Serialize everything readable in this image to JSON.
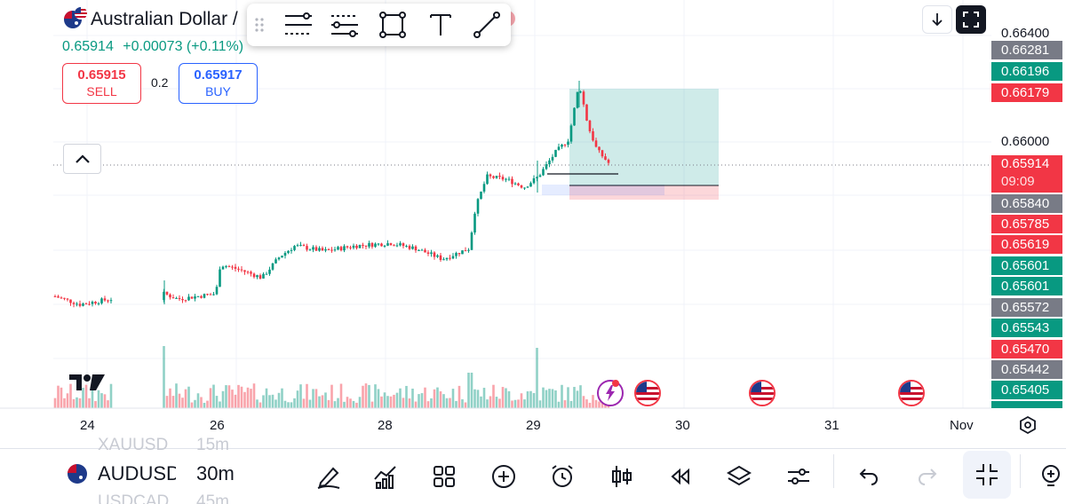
{
  "header": {
    "title": "Australian Dollar /",
    "last_price": "0.65914",
    "change": "+0.00073 (+0.11%)",
    "sell_price": "0.65915",
    "sell_label": "SELL",
    "buy_price": "0.65917",
    "buy_label": "BUY",
    "spread": "0.2"
  },
  "drawing_toolbar": {
    "tools": [
      "drag-handle-icon",
      "long-position-icon",
      "short-position-icon",
      "rectangle-icon",
      "text-icon",
      "trend-line-icon"
    ]
  },
  "top_right": {
    "buttons": [
      "arrow-down-icon",
      "fullscreen-icon"
    ]
  },
  "price_axis": {
    "plain_ticks": [
      "0.66400",
      "0.66000"
    ],
    "badges": [
      {
        "value": "0.66281",
        "color": "#787b86"
      },
      {
        "value": "0.66196",
        "color": "#089981"
      },
      {
        "value": "0.66179",
        "color": "#f23645"
      },
      {
        "value": "0.65914",
        "color": "#f23645",
        "sub": "09:09"
      },
      {
        "value": "0.65840",
        "color": "#787b86"
      },
      {
        "value": "0.65785",
        "color": "#f23645"
      },
      {
        "value": "0.65619",
        "color": "#f23645"
      },
      {
        "value": "0.65601",
        "color": "#089981"
      },
      {
        "value": "0.65601",
        "color": "#089981"
      },
      {
        "value": "0.65572",
        "color": "#787b86"
      },
      {
        "value": "0.65543",
        "color": "#089981"
      },
      {
        "value": "0.65470",
        "color": "#f23645"
      },
      {
        "value": "0.65442",
        "color": "#787b86"
      },
      {
        "value": "0.65405",
        "color": "#089981"
      }
    ]
  },
  "time_axis": {
    "labels": [
      "24",
      "26",
      "28",
      "29",
      "30",
      "31",
      "Nov"
    ]
  },
  "bottom_bar": {
    "symbol": "AUDUSD",
    "timeframe": "30m",
    "symbol_above": "XAUUSD",
    "timeframe_above": "15m",
    "symbol_below": "USDCAD",
    "timeframe_below": "45m",
    "tools": [
      "pen-icon",
      "indicators-icon",
      "layout-grid-icon",
      "add-icon",
      "alarm-icon",
      "candle-type-icon",
      "replay-icon",
      "layers-icon",
      "settings-sliders-icon",
      "undo-icon",
      "redo-icon",
      "exit-fullscreen-icon",
      "lightbulb-icon"
    ]
  },
  "chart_data": {
    "type": "candlestick",
    "symbol": "AUDUSD",
    "interval": "30m",
    "x_tick_labels": [
      "24",
      "26",
      "28",
      "29",
      "30",
      "31",
      "Nov"
    ],
    "y_tick_labels": [
      "0.66400",
      "0.66000"
    ],
    "current_price": 0.65914,
    "countdown": "09:09",
    "approx_close_path": [
      {
        "label": "24",
        "close": 0.6541
      },
      {
        "label": "25",
        "close": 0.6542
      },
      {
        "label": "26",
        "close": 0.6552
      },
      {
        "label": "27",
        "close": 0.656
      },
      {
        "label": "28",
        "close": 0.6558
      },
      {
        "label": "28.5",
        "close": 0.6586
      },
      {
        "label": "29",
        "close": 0.6584
      },
      {
        "label": "29.3",
        "close": 0.662
      },
      {
        "label": "29.5",
        "close": 0.6591
      }
    ],
    "position_tool": {
      "type": "long",
      "target": 0.6619,
      "stop": 0.6581
    }
  }
}
